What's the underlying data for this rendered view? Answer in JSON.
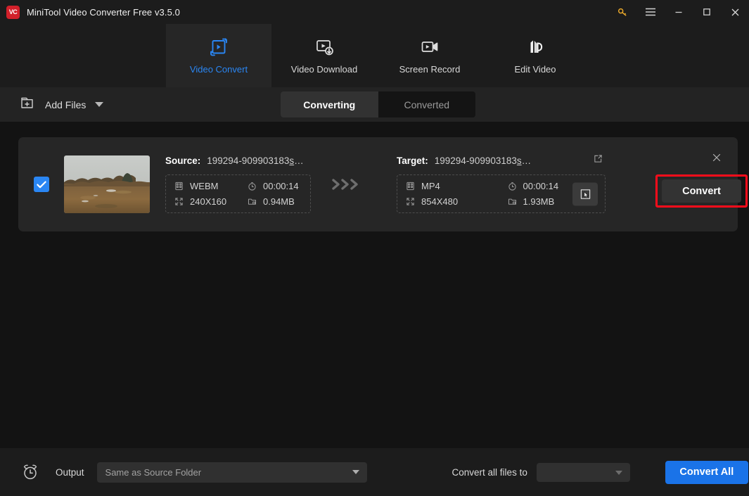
{
  "window": {
    "logo_text": "VC",
    "title": "MiniTool Video Converter Free v3.5.0",
    "controls": [
      {
        "name": "key-icon",
        "label": ""
      },
      {
        "name": "menu-icon",
        "label": ""
      },
      {
        "name": "minimize-icon",
        "label": ""
      },
      {
        "name": "maximize-icon",
        "label": ""
      },
      {
        "name": "close-icon",
        "label": ""
      }
    ]
  },
  "nav": {
    "items": [
      {
        "label": "Video Convert",
        "icon": "video-convert-icon",
        "active": true
      },
      {
        "label": "Video Download",
        "icon": "video-download-icon",
        "active": false
      },
      {
        "label": "Screen Record",
        "icon": "screen-record-icon",
        "active": false
      },
      {
        "label": "Edit Video",
        "icon": "edit-video-icon",
        "active": false
      }
    ],
    "active_color": "#2a86f3"
  },
  "toolbar": {
    "add_files_label": "Add Files",
    "add_files_icon": "folder-plus-icon",
    "tabs": [
      {
        "label": "Converting",
        "active": true
      },
      {
        "label": "Converted",
        "active": false
      }
    ]
  },
  "file_row": {
    "checkbox_checked": true,
    "checkbox_color": "#2a86f3",
    "thumbnail_alt": "heathland-landscape-thumbnail",
    "source": {
      "label": "Source:",
      "filename": "199294-909903183",
      "filename_suffix": "s",
      "filename_ellipsis": "…",
      "format": "WEBM",
      "duration": "00:00:14",
      "resolution": "240X160",
      "size": "0.94MB"
    },
    "arrow_icon": "chevrons-right-icon",
    "target": {
      "label": "Target:",
      "filename": "199294-909903183",
      "filename_suffix": "s",
      "filename_ellipsis": "…",
      "format": "MP4",
      "duration": "00:00:14",
      "resolution": "854X480",
      "size": "1.93MB"
    },
    "edit_icon": "edit-square-icon",
    "pick_format_icon": "cursor-select-icon",
    "close_icon": "close-icon",
    "convert_button": "Convert",
    "highlight_color": "#fd0d1b"
  },
  "footer": {
    "clock_icon": "alarm-clock-icon",
    "output_label": "Output",
    "output_value": "Same as Source Folder",
    "convert_all_label": "Convert all files to",
    "format_value": "",
    "convert_all_button": "Convert All",
    "convert_all_color": "#1a73e8"
  }
}
